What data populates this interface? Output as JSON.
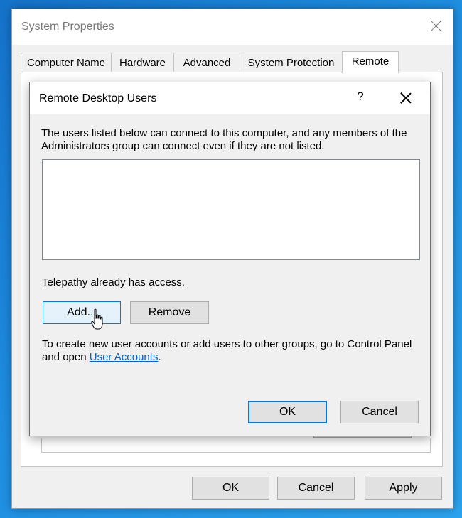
{
  "window": {
    "title": "System Properties",
    "tabs": [
      {
        "label": "Computer Name"
      },
      {
        "label": "Hardware"
      },
      {
        "label": "Advanced"
      },
      {
        "label": "System Protection"
      },
      {
        "label": "Remote"
      }
    ],
    "active_tab": "Remote",
    "buttons": {
      "ok": "OK",
      "cancel": "Cancel",
      "apply": "Apply"
    }
  },
  "dialog": {
    "title": "Remote Desktop Users",
    "help_glyph": "?",
    "description": "The users listed below can connect to this computer, and any members of the Administrators group can connect even if they are not listed.",
    "users": [],
    "access_text": "Telepathy already has access.",
    "add_label": "Add...",
    "remove_label": "Remove",
    "info_prefix": "To create new user accounts or add users to other groups, go to Control Panel and open ",
    "info_link": "User Accounts",
    "info_suffix": ".",
    "ok_label": "OK",
    "cancel_label": "Cancel"
  },
  "icons": {
    "window_close": "close-icon",
    "dialog_close": "close-icon",
    "help": "help-icon",
    "cursor": "hand-cursor-icon"
  },
  "colors": {
    "accent": "#0078d7",
    "link": "#0066cc",
    "desktop": "#1f8ee0"
  }
}
